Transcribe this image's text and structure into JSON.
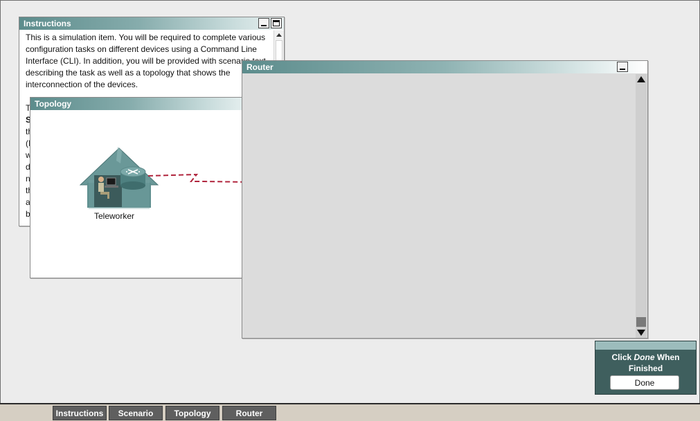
{
  "instructions_window": {
    "title": "Instructions",
    "paragraph1": "This is a simulation item. You will be required to complete various configuration tasks on different devices using a Command Line Interface (CLI). In addition, you will be provided with scenario text describing the task as well as a topology that shows the interconnection of the devices.",
    "partial_lines": [
      "T",
      "S",
      "th",
      "(I",
      "w",
      "d",
      "n",
      "th",
      "a",
      "b"
    ]
  },
  "topology_window": {
    "title": "Topology",
    "device_label": "Teleworker",
    "link_color": "#b0243c"
  },
  "router_window": {
    "title": "Router"
  },
  "done_panel": {
    "message_prefix": "Click ",
    "message_emph": "Done",
    "message_suffix": " When Finished",
    "button_label": "Done"
  },
  "taskbar": {
    "buttons": [
      "Instructions",
      "Scenario",
      "Topology",
      "Router"
    ]
  },
  "colors": {
    "titlebar": "#5c8c8c",
    "panel": "#3f5f5e",
    "taskbar_button": "#5f5f5f"
  }
}
